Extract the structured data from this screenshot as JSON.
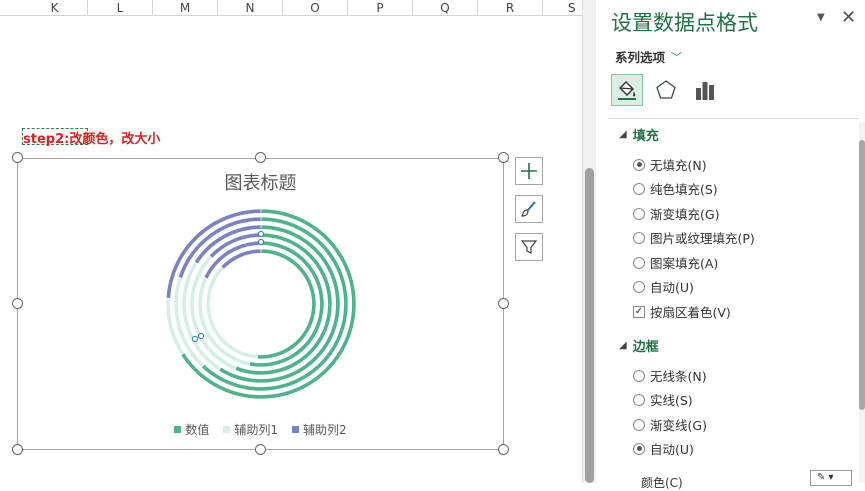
{
  "columns": [
    "K",
    "L",
    "M",
    "N",
    "O",
    "P",
    "Q",
    "R",
    "S"
  ],
  "annotation": "step2:改颜色，改大小",
  "chart": {
    "title": "图表标题",
    "legend": [
      {
        "label": "数值",
        "color": "#4fb28a"
      },
      {
        "label": "辅助列1",
        "color": "#d6efe6"
      },
      {
        "label": "辅助列2",
        "color": "#7a82bf"
      }
    ]
  },
  "chart_data": {
    "type": "doughnut",
    "title": "图表标题",
    "series": [
      {
        "name": "数值",
        "values": [
          0.51,
          0.53,
          0.56,
          0.59,
          0.62,
          0.66
        ]
      },
      {
        "name": "辅助列1",
        "values": [
          0.36,
          0.29,
          0.31,
          0.25,
          0.18,
          0.1
        ]
      },
      {
        "name": "辅助列2",
        "values": [
          0.13,
          0.18,
          0.13,
          0.16,
          0.2,
          0.24
        ]
      }
    ],
    "colors": [
      "#4fb28a",
      "#d6efe6",
      "#7a82bf"
    ]
  },
  "pane": {
    "title": "设置数据点格式",
    "series_options": "系列选项",
    "fill_section": "填充",
    "fill_options": [
      {
        "label": "无填充(N)",
        "type": "radio",
        "checked": true
      },
      {
        "label": "纯色填充(S)",
        "type": "radio",
        "checked": false
      },
      {
        "label": "渐变填充(G)",
        "type": "radio",
        "checked": false
      },
      {
        "label": "图片或纹理填充(P)",
        "type": "radio",
        "checked": false
      },
      {
        "label": "图案填充(A)",
        "type": "radio",
        "checked": false
      },
      {
        "label": "自动(U)",
        "type": "radio",
        "checked": false
      },
      {
        "label": "按扇区着色(V)",
        "type": "check",
        "checked": true
      }
    ],
    "border_section": "边框",
    "border_options": [
      {
        "label": "无线条(N)",
        "checked": false
      },
      {
        "label": "实线(S)",
        "checked": false
      },
      {
        "label": "渐变线(G)",
        "checked": false
      },
      {
        "label": "自动(U)",
        "checked": true
      }
    ],
    "color_label": "颜色(C)"
  }
}
